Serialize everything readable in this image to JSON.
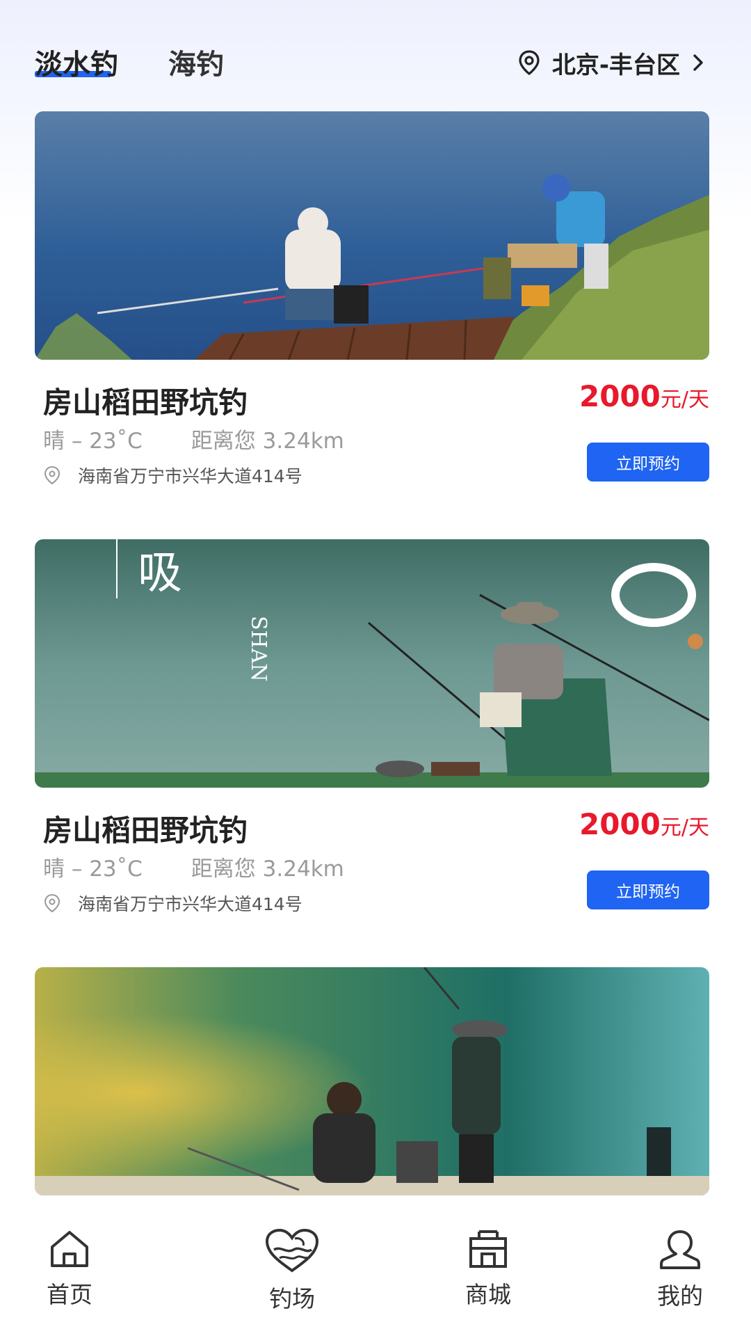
{
  "header": {
    "tabs": [
      {
        "label": "淡水钓",
        "active": true
      },
      {
        "label": "海钓",
        "active": false
      }
    ],
    "location": "北京-丰台区",
    "accent_color": "#1f64f2"
  },
  "cards": [
    {
      "title": "房山稻田野坑钓",
      "weather": "晴 – 23˚C",
      "distance": "距离您 3.24km",
      "address": "海南省万宁市兴华大道414号",
      "price": "2000",
      "price_unit": "元/天",
      "button": "立即预约",
      "image_alt": "两名钓鱼者坐在湖边木台上垂钓"
    },
    {
      "title": "房山稻田野坑钓",
      "weather": "晴 – 23˚C",
      "distance": "距离您 3.24km",
      "address": "海南省万宁市兴华大道414号",
      "price": "2000",
      "price_unit": "元/天",
      "button": "立即预约",
      "image_text": "吸",
      "image_text_vertical": "SHAN",
      "image_alt": "戴帽子的钓鱼者坐在绿色湖边"
    },
    {
      "image_alt": "两名钓鱼者在翠绿湖边垂钓"
    }
  ],
  "bottom_nav": [
    {
      "label": "首页",
      "icon": "home-icon"
    },
    {
      "label": "钓场",
      "icon": "fishing-heart-icon"
    },
    {
      "label": "商城",
      "icon": "store-icon"
    },
    {
      "label": "我的",
      "icon": "user-icon"
    }
  ],
  "colors": {
    "price": "#e8192c",
    "button": "#1f64f2"
  }
}
